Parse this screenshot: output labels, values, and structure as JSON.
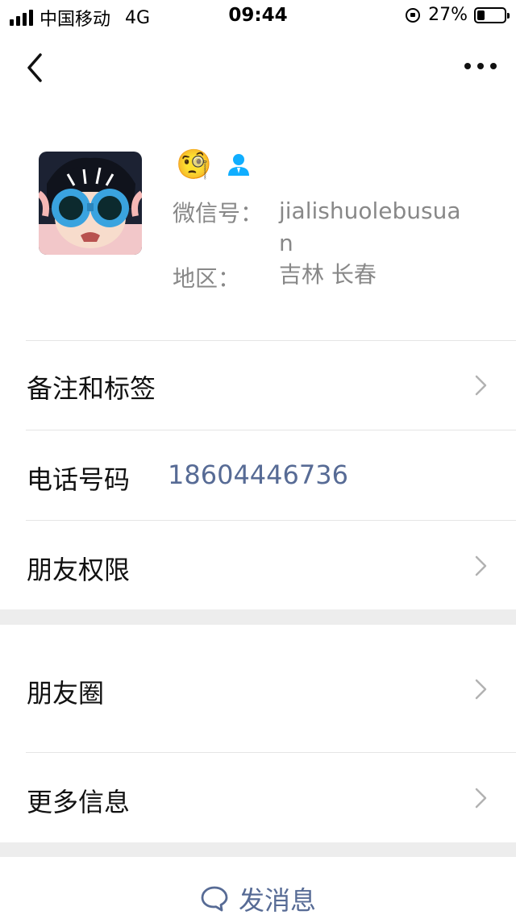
{
  "status_bar": {
    "carrier": "中国移动",
    "network": "4G",
    "time": "09:44",
    "battery": "27%",
    "battery_level": 0.27
  },
  "nav": {
    "back_icon": "chevron-left-icon",
    "more_icon": "more-dots-icon"
  },
  "profile": {
    "nickname_emoji": "🧐",
    "wechat_id_label": "微信号：",
    "wechat_id": "jialishuolebusuan",
    "region_label": "地区：",
    "region": "吉林 长春"
  },
  "rows": {
    "remark_label": "备注和标签",
    "phone_label": "电话号码",
    "phone_value": "18604446736",
    "permissions_label": "朋友权限",
    "moments_label": "朋友圈",
    "more_info_label": "更多信息"
  },
  "actions": {
    "send_message_label": "发消息"
  },
  "colors": {
    "link_blue": "#576b95",
    "contact_icon_blue": "#10aeff",
    "separator_gray": "#ededed"
  }
}
